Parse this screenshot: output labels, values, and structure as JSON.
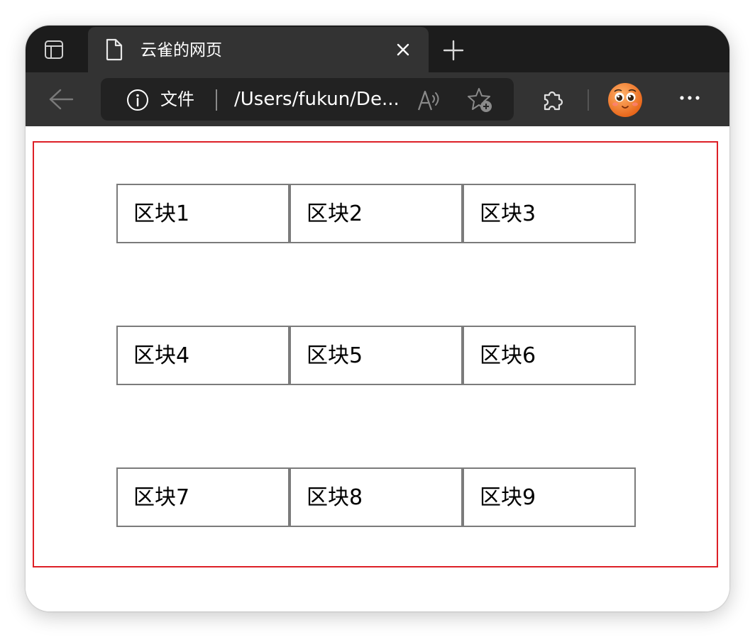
{
  "tab": {
    "title": "云雀的网页"
  },
  "addressbar": {
    "scheme_label": "文件",
    "url": "/Users/fukun/De..."
  },
  "icons": {
    "tab_actions": "tab-actions-icon",
    "page": "page-icon",
    "close": "close-icon",
    "new_tab": "plus-icon",
    "back": "back-arrow-icon",
    "info": "info-icon",
    "read_aloud": "read-aloud-icon",
    "favorite": "favorite-star-plus-icon",
    "extensions": "puzzle-icon",
    "profile": "avatar-emoji",
    "more": "more-dots-icon"
  },
  "colors": {
    "tabbar": "#1c1c1c",
    "toolbar": "#333333",
    "addressbar": "#222222",
    "outer_border": "#dd1f26",
    "block_border": "#7b7b7b"
  },
  "blocks": [
    {
      "label": "区块1"
    },
    {
      "label": "区块2"
    },
    {
      "label": "区块3"
    },
    {
      "label": "区块4"
    },
    {
      "label": "区块5"
    },
    {
      "label": "区块6"
    },
    {
      "label": "区块7"
    },
    {
      "label": "区块8"
    },
    {
      "label": "区块9"
    }
  ]
}
